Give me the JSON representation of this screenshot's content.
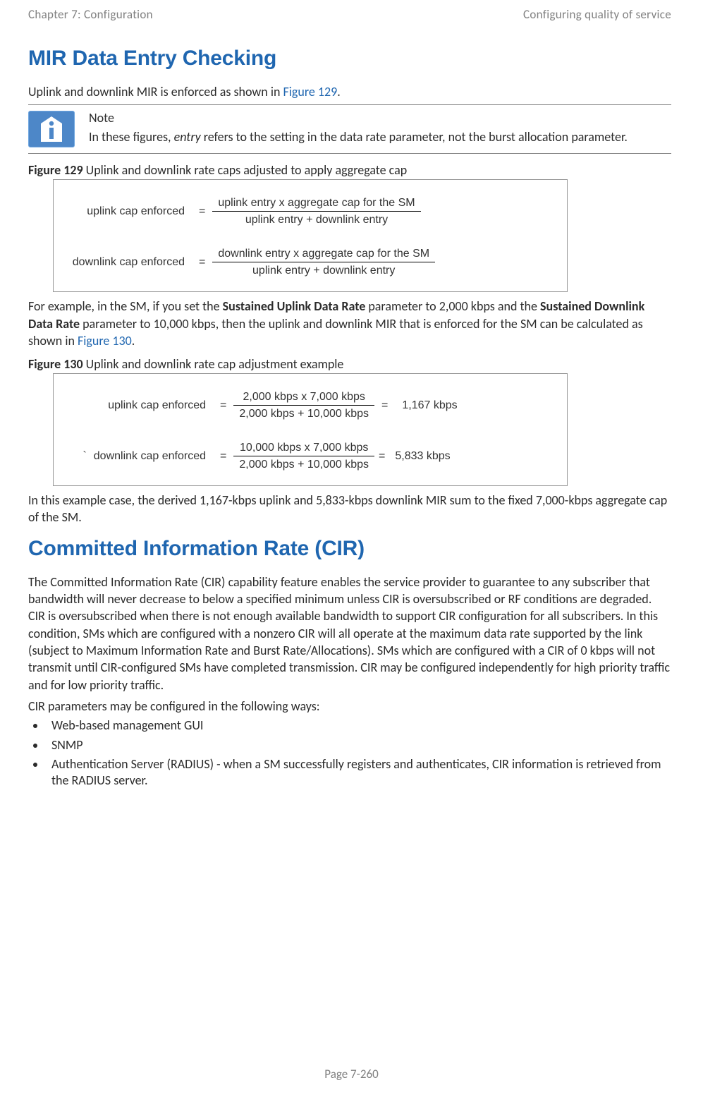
{
  "header": {
    "left": "Chapter 7:  Configuration",
    "right": "Configuring quality of service"
  },
  "section1": {
    "heading": "MIR Data Entry Checking",
    "intro_pre": "Uplink and downlink MIR is enforced as shown in ",
    "intro_link": "Figure 129",
    "intro_post": ".",
    "note_label": "Note",
    "note_body_1": "In these figures, ",
    "note_body_em": "entry",
    "note_body_2": " refers to the setting in the data rate parameter, not the burst allocation parameter."
  },
  "fig129": {
    "label_bold": "Figure 129",
    "label_rest": " Uplink and downlink rate caps adjusted to apply aggregate cap",
    "eq1": {
      "lhs": "uplink cap  enforced",
      "num": "uplink entry  x  aggregate cap for the SM",
      "den": "uplink entry  +   downlink entry"
    },
    "eq2": {
      "lhs": "downlink cap enforced",
      "num": "downlink entry  x  aggregate cap for the SM",
      "den": "uplink entry  +   downlink entry"
    }
  },
  "para2": {
    "t1": "For example, in the SM, if you set the ",
    "s1": "Sustained Uplink Data Rate",
    "t2": " parameter to 2,000 kbps and the ",
    "s2": "Sustained Downlink Data Rate",
    "t3": " parameter to 10,000 kbps, then the uplink and downlink MIR that is enforced for the SM can be calculated as shown in ",
    "link": "Figure 130",
    "t4": "."
  },
  "fig130": {
    "label_bold": "Figure 130",
    "label_rest": " Uplink and downlink rate cap adjustment example",
    "eq1": {
      "lhs": "uplink cap enforced",
      "num": "2,000 kbps  x  7,000 kbps",
      "den": "2,000 kbps  +   10,000 kbps",
      "res": "1,167 kbps"
    },
    "eq2": {
      "lhs_pre": "`",
      "lhs": "downlink cap enforced",
      "num": "10,000 kbps  x  7,000 kbps",
      "den": "2,000 kbps  +   10,000 kbps",
      "res": "5,833 kbps"
    }
  },
  "para3": "In this example case, the derived 1,167-kbps uplink and 5,833-kbps downlink MIR sum to the fixed 7,000-kbps aggregate cap of the SM.",
  "section2": {
    "heading": "Committed Information Rate (CIR)",
    "para": "The Committed Information Rate (CIR) capability feature enables the service provider to guarantee to any subscriber that bandwidth will never decrease to below a specified minimum unless CIR is oversubscribed or RF conditions are degraded. CIR is oversubscribed when there is not enough available bandwidth to support CIR configuration for all subscribers. In this condition, SMs which are configured with a nonzero CIR will all operate at the maximum data rate supported by the link (subject to Maximum Information Rate and Burst Rate/Allocations). SMs which are configured with a CIR of 0 kbps will not transmit until CIR-configured SMs have completed transmission. CIR may be configured independently for high priority traffic and for low priority traffic.",
    "listintro": "CIR parameters may be configured in the following ways:",
    "items": [
      "Web-based management GUI",
      "SNMP",
      "Authentication Server (RADIUS) - when a SM successfully registers and authenticates, CIR information is retrieved from the RADIUS server."
    ]
  },
  "footer": "Page 7-260",
  "chart_data": {
    "type": "table",
    "title": "Uplink and downlink rate cap adjustment example",
    "inputs": {
      "sustained_uplink_data_rate_kbps": 2000,
      "sustained_downlink_data_rate_kbps": 10000,
      "aggregate_cap_kbps": 7000
    },
    "derived": {
      "uplink_cap_enforced_kbps": 1167,
      "downlink_cap_enforced_kbps": 5833
    },
    "formulae": {
      "uplink_cap_enforced": "uplink_entry * aggregate_cap / (uplink_entry + downlink_entry)",
      "downlink_cap_enforced": "downlink_entry * aggregate_cap / (uplink_entry + downlink_entry)"
    }
  }
}
